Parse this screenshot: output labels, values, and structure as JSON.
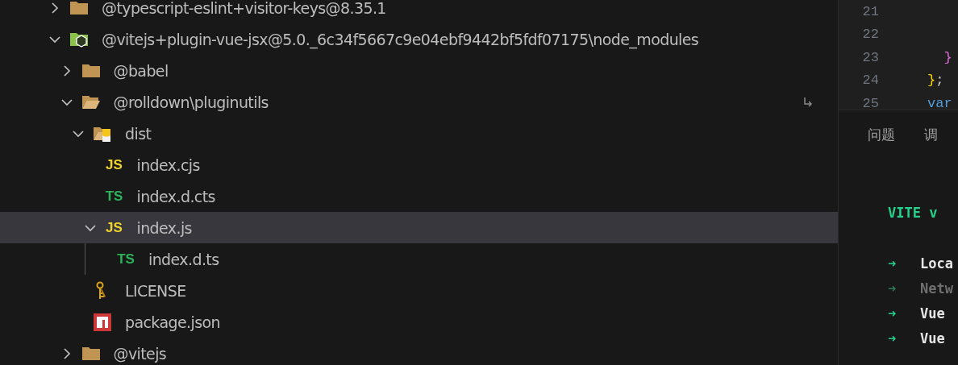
{
  "explorer": {
    "items": [
      {
        "label": "@typescript-eslint+visitor-keys@8.35.1",
        "kind": "folder",
        "expanded": false,
        "selected": false,
        "symlink": false
      },
      {
        "label": "@vitejs+plugin-vue-jsx@5.0._6c34f5667c9e04ebf9442bf5fdf07175\\node_modules",
        "kind": "nodefolder",
        "expanded": true,
        "selected": false,
        "symlink": false,
        "children": [
          {
            "label": "@babel",
            "kind": "folder",
            "expanded": false,
            "selected": false,
            "symlink": false
          },
          {
            "label": "@rolldown\\pluginutils",
            "kind": "folder",
            "expanded": true,
            "selected": false,
            "symlink": true,
            "children": [
              {
                "label": "dist",
                "kind": "distfolder",
                "expanded": true,
                "selected": false,
                "symlink": false,
                "children": [
                  {
                    "label": "index.cjs",
                    "kind": "js",
                    "badge": "JS",
                    "selected": false,
                    "symlink": false
                  },
                  {
                    "label": "index.d.cts",
                    "kind": "ts",
                    "badge": "TS",
                    "selected": false,
                    "symlink": false
                  },
                  {
                    "label": "index.js",
                    "kind": "js",
                    "badge": "JS",
                    "expanded": true,
                    "selected": true,
                    "symlink": false,
                    "children": [
                      {
                        "label": "index.d.ts",
                        "kind": "ts",
                        "badge": "TS",
                        "selected": false,
                        "symlink": false
                      }
                    ]
                  }
                ]
              },
              {
                "label": "LICENSE",
                "kind": "license",
                "selected": false,
                "symlink": false
              },
              {
                "label": "package.json",
                "kind": "npm",
                "selected": false,
                "symlink": false
              }
            ]
          },
          {
            "label": "@vitejs",
            "kind": "folder",
            "expanded": false,
            "selected": false,
            "symlink": false
          }
        ]
      }
    ]
  },
  "editor": {
    "lines": [
      {
        "number": "21"
      },
      {
        "number": "22"
      },
      {
        "number": "23",
        "tokens": [
          {
            "text": "  }",
            "color": "#da70d6"
          }
        ]
      },
      {
        "number": "24",
        "tokens": [
          {
            "text": "}",
            "color": "#ffd700"
          },
          {
            "text": ";",
            "color": "#cccccc"
          }
        ]
      },
      {
        "number": "25",
        "tokens": [
          {
            "text": "var",
            "color": "#569cd6"
          }
        ]
      }
    ]
  },
  "panel": {
    "tabs": [
      {
        "label": "问题",
        "selected": false
      },
      {
        "label": "调",
        "selected": false
      }
    ],
    "terminal": {
      "title": "VITE v",
      "lines": [
        {
          "arrow": "➜",
          "text": "Loca",
          "kind": "normal"
        },
        {
          "arrow": "➜",
          "text": "Netw",
          "kind": "dim"
        },
        {
          "arrow": "➜",
          "text": "Vue",
          "kind": "normal"
        },
        {
          "arrow": "➜",
          "text": "Vue",
          "kind": "normal"
        }
      ]
    }
  }
}
